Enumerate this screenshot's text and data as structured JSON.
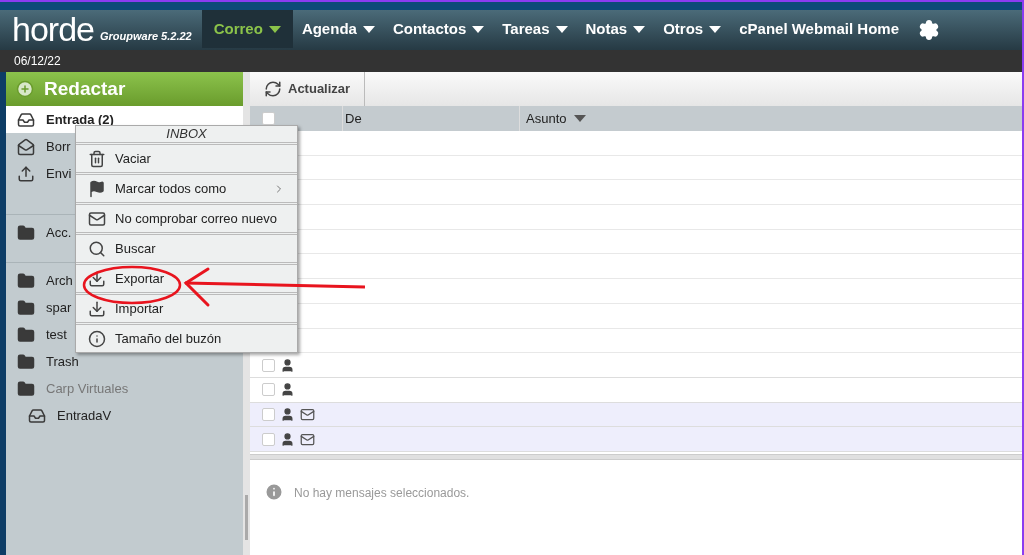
{
  "logo": {
    "name": "horde",
    "product": "Groupware 5.2.22"
  },
  "nav": [
    {
      "label": "Correo",
      "selected": true,
      "dropdown": true
    },
    {
      "label": "Agenda",
      "selected": false,
      "dropdown": true
    },
    {
      "label": "Contactos",
      "selected": false,
      "dropdown": true
    },
    {
      "label": "Tareas",
      "selected": false,
      "dropdown": true
    },
    {
      "label": "Notas",
      "selected": false,
      "dropdown": true
    },
    {
      "label": "Otros",
      "selected": false,
      "dropdown": true
    },
    {
      "label": "cPanel Webmail Home",
      "selected": false,
      "dropdown": false
    }
  ],
  "date": "06/12/22",
  "compose": "Redactar",
  "folder_groups": [
    [
      {
        "label": "Entrada (2)",
        "kind": "inbox",
        "selected": true
      },
      {
        "label": "Borr",
        "kind": "drafts",
        "selected": false
      },
      {
        "label": "Envi",
        "kind": "sent",
        "selected": false
      }
    ],
    [
      {
        "label": "Acc.",
        "kind": "folder",
        "selected": false
      }
    ],
    [
      {
        "label": "Arch",
        "kind": "folder",
        "selected": false
      },
      {
        "label": "spar",
        "kind": "folder",
        "selected": false
      },
      {
        "label": "test",
        "kind": "folder",
        "selected": false
      },
      {
        "label": "Trash",
        "kind": "folder",
        "selected": false
      },
      {
        "label": "Carp Virtuales",
        "kind": "virtual",
        "selected": false
      },
      {
        "label": "EntradaV",
        "kind": "virtual-inbox",
        "selected": false
      }
    ]
  ],
  "toolbar": {
    "refresh": "Actualizar"
  },
  "select_all": {
    "checked": false
  },
  "columns": [
    "De",
    "Asunto"
  ],
  "messages": [
    {
      "unread": false,
      "checked": false
    },
    {
      "unread": false,
      "checked": false
    },
    {
      "unread": true,
      "checked": false
    },
    {
      "unread": true,
      "checked": false
    }
  ],
  "context_menu": {
    "title": "INBOX",
    "items": [
      {
        "label": "Vaciar",
        "kind": "trash",
        "submenu": false,
        "highlighted": false
      },
      {
        "label": "Marcar todos como",
        "kind": "flag",
        "submenu": true,
        "highlighted": false
      },
      {
        "label": "No comprobar correo nuevo",
        "kind": "envelope",
        "submenu": false,
        "highlighted": false
      },
      {
        "label": "Buscar",
        "kind": "search",
        "submenu": false,
        "highlighted": false
      },
      {
        "label": "Exportar",
        "kind": "download",
        "submenu": false,
        "highlighted": true
      },
      {
        "label": "Importar",
        "kind": "download",
        "submenu": false,
        "highlighted": false
      },
      {
        "label": "Tamaño del buzón",
        "kind": "info",
        "submenu": false,
        "highlighted": false
      }
    ]
  },
  "preview": {
    "message": "No hay mensajes seleccionados."
  }
}
